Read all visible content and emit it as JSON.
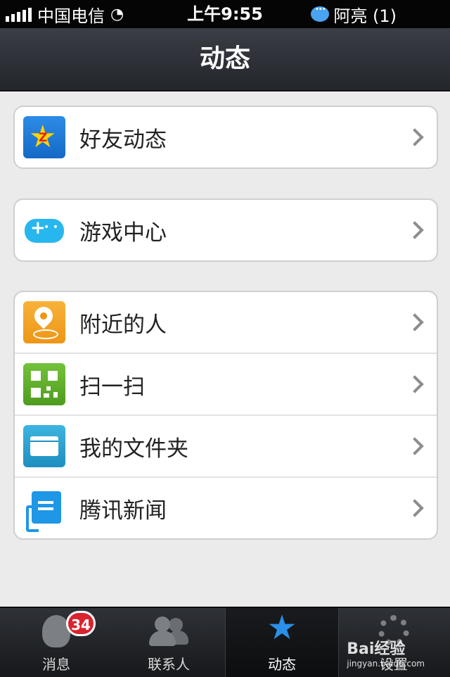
{
  "status_bar": {
    "carrier": "中国电信",
    "time": "上午9:55",
    "notification": "阿亮 (1)"
  },
  "nav": {
    "title": "动态"
  },
  "groups": [
    {
      "items": [
        {
          "label": "好友动态",
          "icon": "qzone-star-icon"
        }
      ]
    },
    {
      "items": [
        {
          "label": "游戏中心",
          "icon": "gamepad-icon"
        }
      ]
    },
    {
      "items": [
        {
          "label": "附近的人",
          "icon": "location-pin-icon"
        },
        {
          "label": "扫一扫",
          "icon": "qr-scan-icon"
        },
        {
          "label": "我的文件夹",
          "icon": "folder-icon"
        },
        {
          "label": "腾讯新闻",
          "icon": "news-icon"
        }
      ]
    }
  ],
  "tabbar": {
    "tabs": [
      {
        "label": "消息",
        "badge": "34",
        "icon": "penguin-icon"
      },
      {
        "label": "联系人",
        "icon": "contacts-icon"
      },
      {
        "label": "动态",
        "icon": "star-icon",
        "active": true
      },
      {
        "label": "设置",
        "icon": "gear-icon"
      }
    ]
  },
  "watermark": {
    "brand": "Bai经验",
    "url": "jingyan.baidu.com"
  },
  "colors": {
    "accent": "#2a8fe8",
    "badge": "#d9232e",
    "navbar": "#2c2f34"
  }
}
